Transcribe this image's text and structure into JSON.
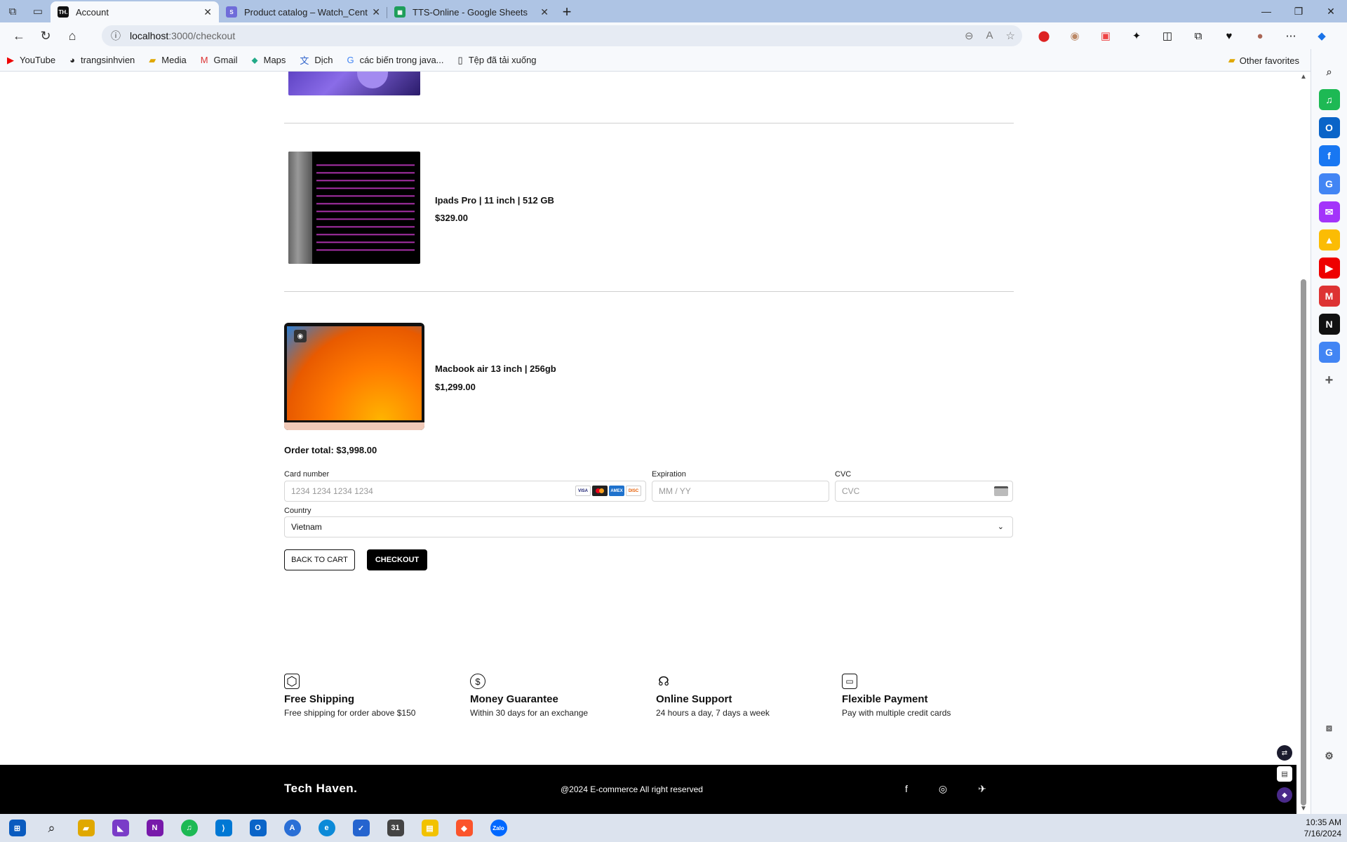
{
  "browser": {
    "tabs": [
      {
        "title": "Account",
        "favicon": "TH.",
        "active": true
      },
      {
        "title": "Product catalog – Watch_Center",
        "favicon": "S",
        "active": false
      },
      {
        "title": "TTS-Online - Google Sheets",
        "favicon": "▦",
        "active": false
      }
    ],
    "address": {
      "host": "localhost",
      "path": ":3000/checkout"
    },
    "bookmarks": [
      "YouTube",
      "trangsinhvien",
      "Media",
      "Gmail",
      "Maps",
      "Dịch",
      "các biến trong java...",
      "Tệp đã tải xuống"
    ],
    "other_favorites": "Other favorites"
  },
  "cart": {
    "items": [
      {
        "name": "Ipads Pro | 11 inch | 512 GB",
        "price": "$329.00"
      },
      {
        "name": "Macbook air 13 inch | 256gb",
        "price": "$1,299.00"
      }
    ],
    "order_total": "Order total: $3,998.00"
  },
  "payment": {
    "card_number_label": "Card number",
    "card_number_placeholder": "1234 1234 1234 1234",
    "expiration_label": "Expiration",
    "expiration_placeholder": "MM / YY",
    "cvc_label": "CVC",
    "cvc_placeholder": "CVC",
    "country_label": "Country",
    "country_value": "Vietnam",
    "card_brands": [
      "VISA",
      "MC",
      "AMEX",
      "DISCOVER"
    ]
  },
  "actions": {
    "back": "BACK TO CART",
    "checkout": "CHECKOUT"
  },
  "features": [
    {
      "icon": "box-icon",
      "title": "Free Shipping",
      "desc": "Free shipping for order above $150"
    },
    {
      "icon": "dollar-icon",
      "title": "Money Guarantee",
      "desc": "Within 30 days for an exchange"
    },
    {
      "icon": "headphones-icon",
      "title": "Online Support",
      "desc": "24 hours a day, 7 days a week"
    },
    {
      "icon": "card-icon",
      "title": "Flexible Payment",
      "desc": "Pay with multiple credit cards"
    }
  ],
  "footer": {
    "brand": "Tech Haven.",
    "copyright": "@2024 E-commerce All right reserved",
    "social": [
      "facebook-icon",
      "instagram-icon",
      "twitter-icon"
    ]
  },
  "system": {
    "time": "10:35 AM",
    "date": "7/16/2024"
  },
  "colors": {
    "accent": "#000000",
    "tab_bar": "#aec4e4"
  }
}
